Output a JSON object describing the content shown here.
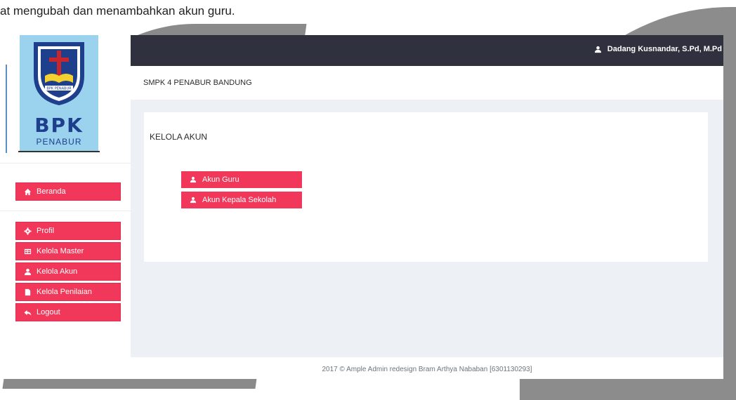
{
  "doc": {
    "caption": "at mengubah dan menambahkan akun guru."
  },
  "logo": {
    "name": "BPK",
    "sub": "PENABUR",
    "motto": "IMAN, ILMU dan PELAYANAN",
    "banner": "BPK PENABUR"
  },
  "header": {
    "user_name": "Dadang Kusnandar, S.Pd, M.Pd",
    "icon": "user-icon"
  },
  "titlebar": {
    "title": "SMPK 4 PENABUR BANDUNG"
  },
  "sidebar": {
    "items": [
      {
        "label": "Beranda",
        "icon": "home-icon"
      },
      {
        "label": "Profil",
        "icon": "gear-icon"
      },
      {
        "label": "Kelola Master",
        "icon": "table-icon"
      },
      {
        "label": "Kelola Akun",
        "icon": "user-icon"
      },
      {
        "label": "Kelola Penilaian",
        "icon": "file-icon"
      },
      {
        "label": "Logout",
        "icon": "reply-icon"
      }
    ]
  },
  "main": {
    "heading": "KELOLA AKUN",
    "buttons": [
      {
        "label": "Akun Guru",
        "icon": "user-icon"
      },
      {
        "label": "Akun Kepala Sekolah",
        "icon": "user-icon"
      }
    ]
  },
  "footer": {
    "text": "2017 © Ample Admin redesign Bram Arthya Nababan [6301130293]"
  },
  "colors": {
    "accent": "#f1385a",
    "topbar": "#2f323e",
    "background": "#edf1f5",
    "logo_bg": "#9bd3ee"
  }
}
